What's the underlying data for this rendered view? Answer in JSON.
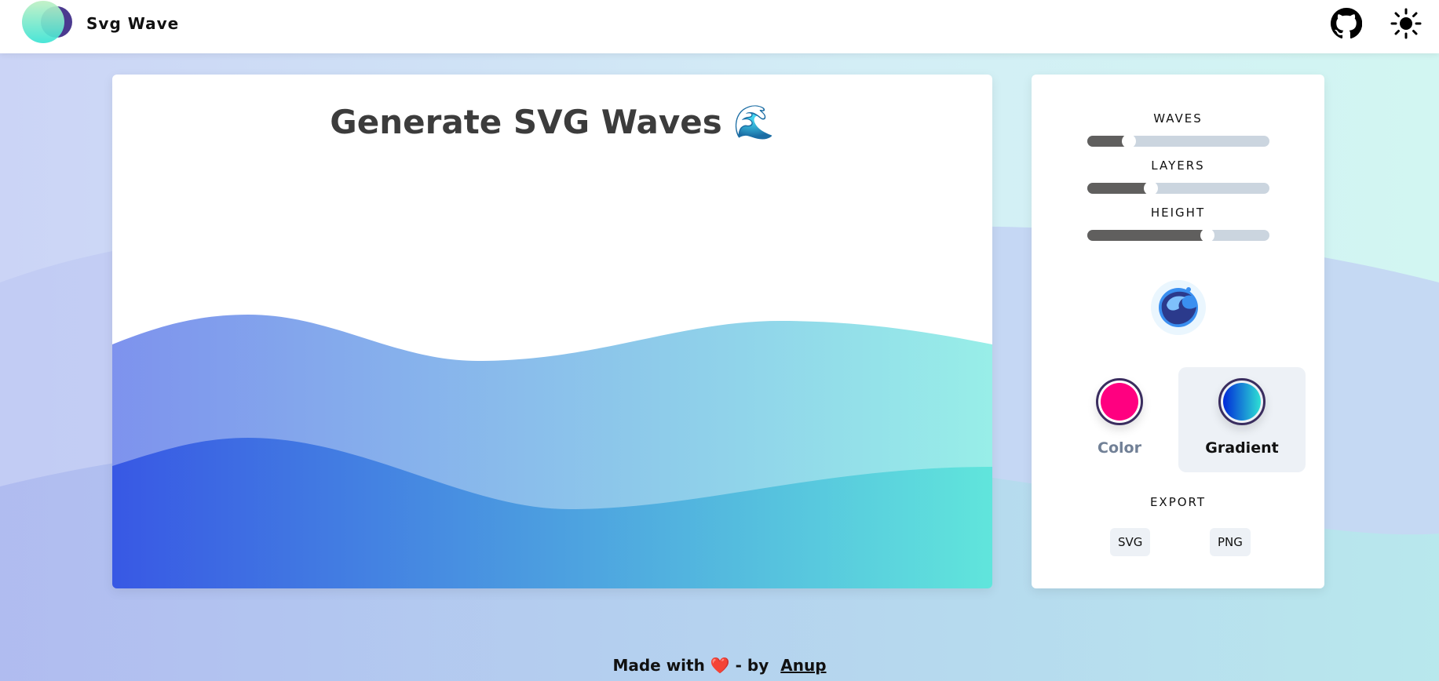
{
  "header": {
    "brand": "Svg Wave",
    "github_icon": "github-icon",
    "theme_icon": "sun-icon"
  },
  "main": {
    "title": "Generate SVG Waves 🌊"
  },
  "controls": {
    "waves": {
      "label": "WAVES",
      "value": 0.23
    },
    "layers": {
      "label": "LAYERS",
      "value": 0.35
    },
    "height": {
      "label": "HEIGHT",
      "value": 0.66
    },
    "random_icon": "water-wave-icon",
    "color": {
      "label": "Color",
      "value": "#ff0080"
    },
    "gradient": {
      "label": "Gradient",
      "from": "#0029d8",
      "to": "#2ee0d4",
      "selected": true
    },
    "export": {
      "label": "EXPORT",
      "svg": "SVG",
      "png": "PNG"
    }
  },
  "wave_colors": {
    "from": "#3858e4",
    "to": "#60e5dc"
  },
  "footer": {
    "made_with": "Made with",
    "heart": "❤️",
    "by": "- by",
    "author": "Anup"
  }
}
